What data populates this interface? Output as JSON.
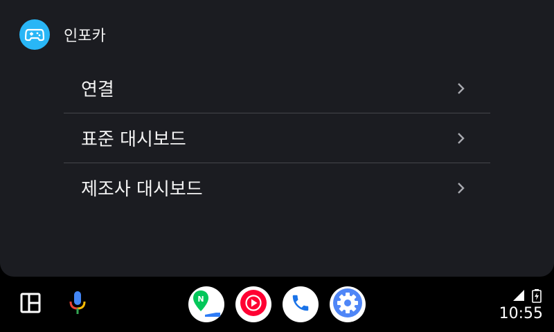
{
  "app": {
    "title": "인포카",
    "icon": "car-controller-icon",
    "accent": "#29b6f6"
  },
  "menu": {
    "items": [
      {
        "label": "연결"
      },
      {
        "label": "표준 대시보드"
      },
      {
        "label": "제조사 대시보드"
      }
    ]
  },
  "taskbar": {
    "left": [
      {
        "icon": "dashboard-layout-icon"
      },
      {
        "icon": "microphone-icon"
      }
    ],
    "apps": [
      {
        "icon": "naver-map-icon"
      },
      {
        "icon": "youtube-music-icon"
      },
      {
        "icon": "phone-icon"
      },
      {
        "icon": "settings-gear-icon"
      }
    ]
  },
  "status": {
    "time": "10:55"
  },
  "colors": {
    "panel": "#1b1c21",
    "divider": "#45464c",
    "taskbar": "#000000"
  }
}
